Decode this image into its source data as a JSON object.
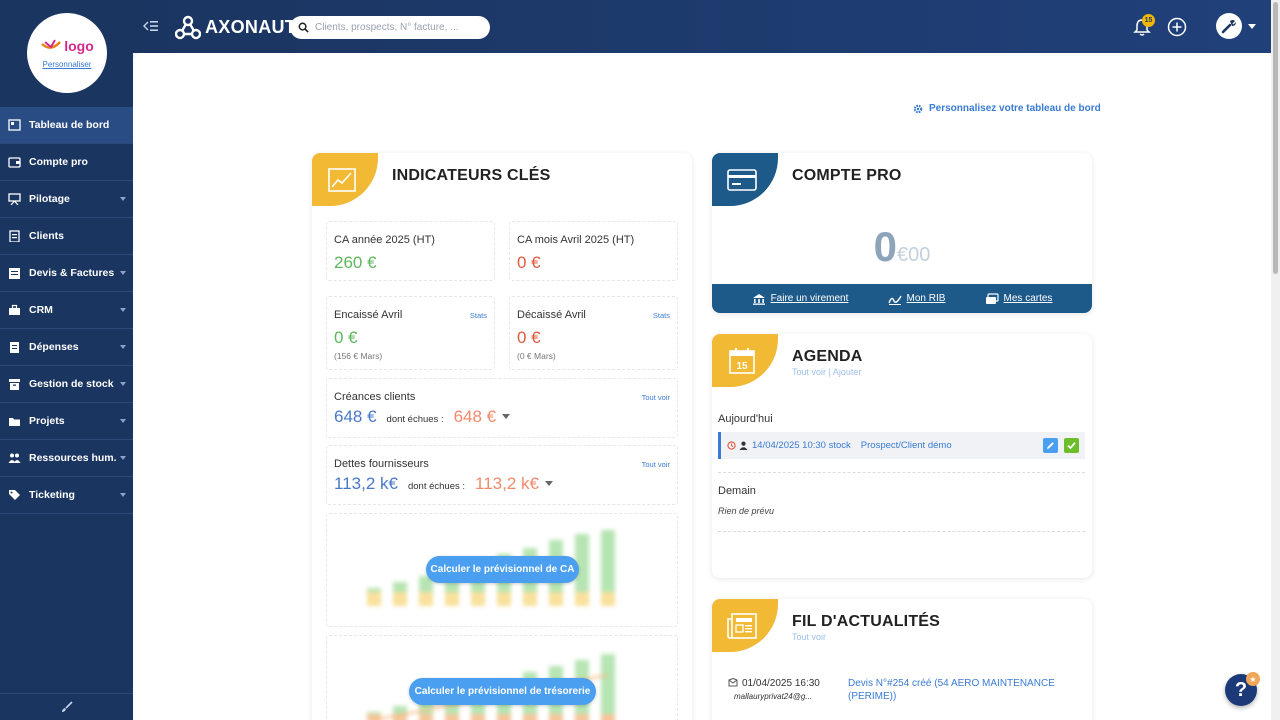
{
  "brand": {
    "name": "AXONAUT"
  },
  "search": {
    "placeholder": "Clients, prospects, N° facture, ..."
  },
  "header": {
    "notification_count": "15"
  },
  "logo": {
    "text": "logo",
    "customize_label": "Personnaliser"
  },
  "sidebar": {
    "items": [
      {
        "label": "Tableau de bord",
        "icon": "dashboard-icon",
        "active": true,
        "has_submenu": false
      },
      {
        "label": "Compte pro",
        "icon": "wallet-icon",
        "active": false,
        "has_submenu": false
      },
      {
        "label": "Pilotage",
        "icon": "chart-board-icon",
        "active": false,
        "has_submenu": true
      },
      {
        "label": "Clients",
        "icon": "address-book-icon",
        "active": false,
        "has_submenu": false
      },
      {
        "label": "Devis & Factures",
        "icon": "invoice-icon",
        "active": false,
        "has_submenu": true
      },
      {
        "label": "CRM",
        "icon": "briefcase-icon",
        "active": false,
        "has_submenu": true
      },
      {
        "label": "Dépenses",
        "icon": "receipt-icon",
        "active": false,
        "has_submenu": true
      },
      {
        "label": "Gestion de stock",
        "icon": "archive-icon",
        "active": false,
        "has_submenu": true
      },
      {
        "label": "Projets",
        "icon": "folder-icon",
        "active": false,
        "has_submenu": true
      },
      {
        "label": "Ressources hum.",
        "icon": "users-icon",
        "active": false,
        "has_submenu": true
      },
      {
        "label": "Ticketing",
        "icon": "tag-icon",
        "active": false,
        "has_submenu": true
      }
    ]
  },
  "main": {
    "customize_dashboard": "Personnalisez votre tableau de bord"
  },
  "indicators": {
    "title": "INDICATEURS CLÉS",
    "ca_year": {
      "label": "CA année 2025 (HT)",
      "value": "260 €"
    },
    "ca_month": {
      "label": "CA mois Avril 2025 (HT)",
      "value": "0 €"
    },
    "cashed": {
      "label": "Encaissé Avril",
      "value": "0 €",
      "previous": "(156 € Mars)",
      "link": "Stats"
    },
    "disbursed": {
      "label": "Décaissé Avril",
      "value": "0 €",
      "previous": "(0 € Mars)",
      "link": "Stats"
    },
    "receivables": {
      "label": "Créances clients",
      "value": "648 €",
      "due_label": "dont échues :",
      "due_value": "648 €",
      "link": "Tout voir"
    },
    "payables": {
      "label": "Dettes fournisseurs",
      "value": "113,2 k€",
      "due_label": "dont échues :",
      "due_value": "113,2 k€",
      "link": "Tout voir"
    },
    "forecast_ca_button": "Calculer le prévisionnel de CA",
    "forecast_cash_button": "Calculer le prévisionnel de trésorerie"
  },
  "compte_pro": {
    "title": "COMPTE PRO",
    "balance_int": "0",
    "balance_dec": "€00",
    "actions": [
      {
        "label": "Faire un virement",
        "icon": "transfer-icon"
      },
      {
        "label": "Mon RIB",
        "icon": "signature-icon"
      },
      {
        "label": "Mes cartes",
        "icon": "cards-icon"
      }
    ]
  },
  "agenda": {
    "title": "AGENDA",
    "see_all": "Tout voir",
    "separator": "|",
    "add": "Ajouter",
    "today_label": "Aujourd'hui",
    "event": {
      "datetime": "14/04/2025 10:30 stock",
      "client": "Prospect/Client démo"
    },
    "tomorrow_label": "Demain",
    "nothing": "Rien de prévu"
  },
  "feed": {
    "title": "FIL D'ACTUALITÉS",
    "see_all": "Tout voir",
    "entry": {
      "date": "01/04/2025 16:30",
      "user": "mallauryprivat24@g...",
      "text": "Devis N°#254 créé (54 AERO MAINTENANCE (PERIME))"
    }
  },
  "colors": {
    "sidebar": "#1b3561",
    "accent": "#3a7bd5",
    "badge_yellow": "#f2b705",
    "badge_blue": "#1d5a8a",
    "green": "#5cb85c",
    "red": "#e15a3e"
  }
}
